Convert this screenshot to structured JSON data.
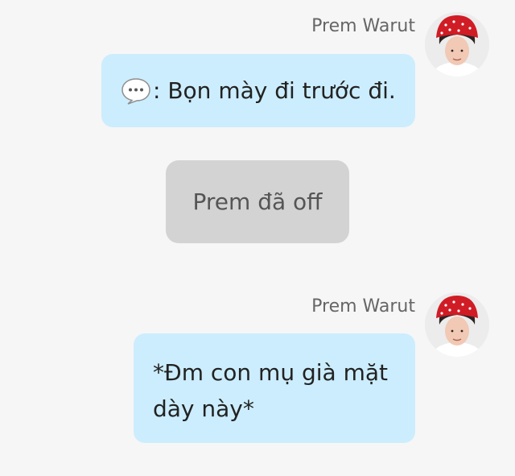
{
  "messages": [
    {
      "sender": "Prem Warut",
      "icon": "speech-balloon-icon",
      "text": ": Bọn mày đi trước đi."
    },
    {
      "sender": "Prem Warut",
      "line1": "*Đm con mụ già mặt",
      "line2": "dày này*"
    }
  ],
  "system_notice": "Prem đã off",
  "colors": {
    "background": "#f6f6f6",
    "bubble": "#ccedfd",
    "system_pill": "#d3d3d3",
    "sender_text": "#666666"
  }
}
